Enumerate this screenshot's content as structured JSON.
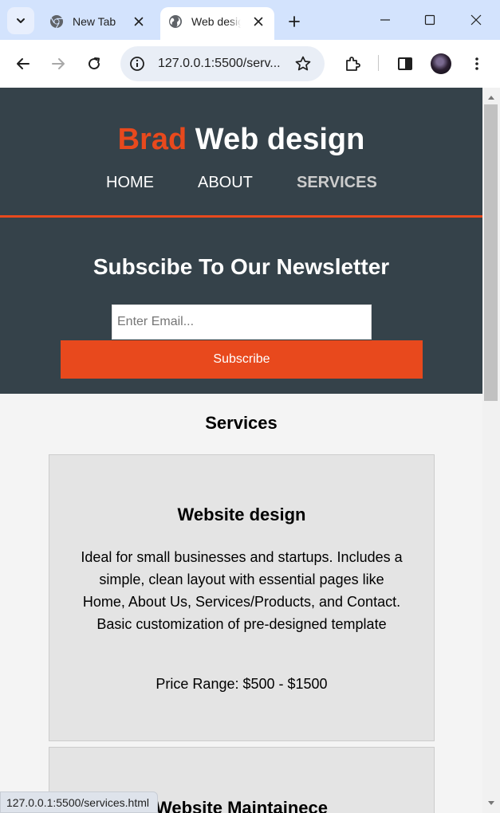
{
  "browser": {
    "tabs": [
      {
        "title": "New Tab",
        "active": false,
        "icon": "chrome-icon"
      },
      {
        "title": "Web design",
        "active": true,
        "icon": "globe-icon"
      }
    ],
    "address": "127.0.0.1:5500/serv...",
    "status_url": "127.0.0.1:5500/services.html"
  },
  "site": {
    "brand_highlight": "Brad",
    "brand_rest": " Web design",
    "nav": [
      {
        "label": "HOME",
        "current": false
      },
      {
        "label": "ABOUT",
        "current": false
      },
      {
        "label": "SERVICES",
        "current": true
      }
    ],
    "newsletter": {
      "title": "Subscibe To Our Newsletter",
      "placeholder": "Enter Email...",
      "button": "Subscribe"
    },
    "services_heading": "Services",
    "services": [
      {
        "title": "Website design",
        "description": "Ideal for small businesses and startups. Includes a simple, clean layout with essential pages like Home, About Us, Services/Products, and Contact. Basic customization of pre-designed template",
        "price": "Price Range: $500 - $1500"
      },
      {
        "title": "Website Maintainece"
      }
    ]
  },
  "colors": {
    "header_bg": "#35424a",
    "accent": "#e8491d",
    "body_bg": "#f4f4f4",
    "card_bg": "#e4e4e4"
  }
}
